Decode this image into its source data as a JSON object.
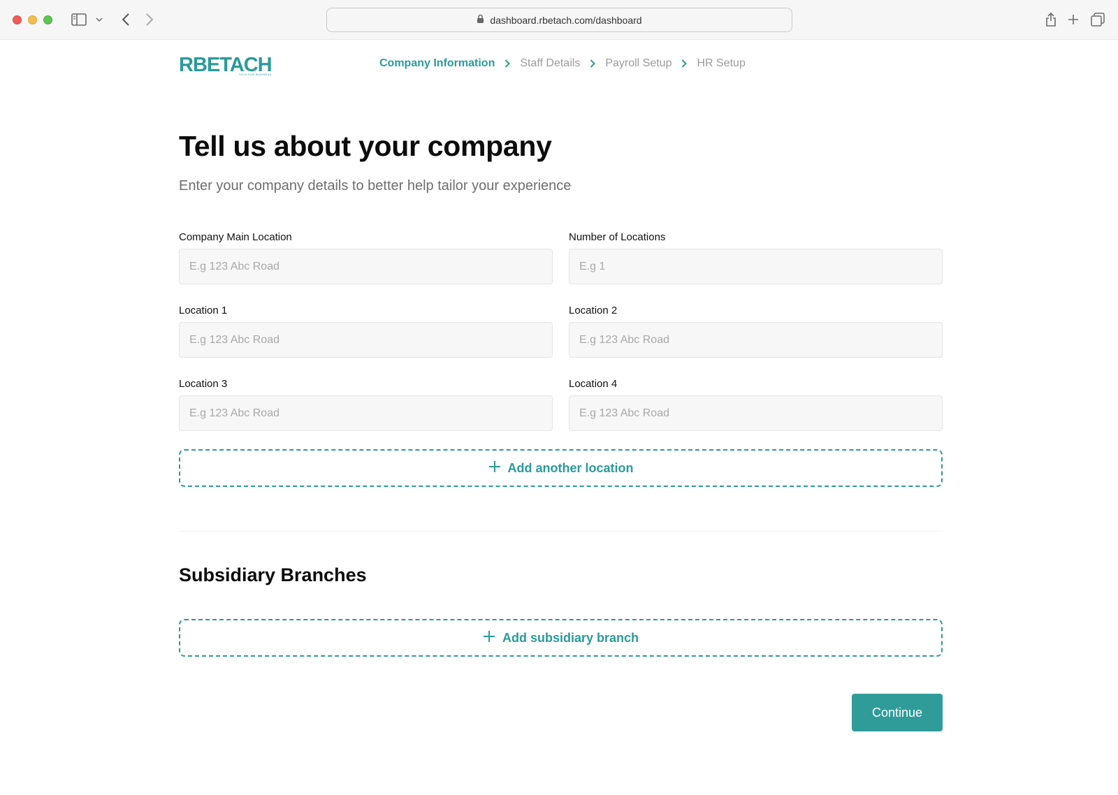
{
  "browser": {
    "url": "dashboard.rbetach.com/dashboard"
  },
  "logo": {
    "name": "RBETACH",
    "tagline": "TECH FOR BUSINESS"
  },
  "stepper": {
    "steps": [
      {
        "label": "Company Information",
        "active": true
      },
      {
        "label": "Staff Details",
        "active": false
      },
      {
        "label": "Payroll Setup",
        "active": false
      },
      {
        "label": "HR Setup",
        "active": false
      }
    ]
  },
  "page": {
    "title": "Tell us about your company",
    "subtitle": "Enter your company details to better help tailor your experience"
  },
  "form": {
    "main_location": {
      "label": "Company Main Location",
      "placeholder": "E.g 123 Abc Road",
      "value": ""
    },
    "num_locations": {
      "label": "Number of Locations",
      "placeholder": "E.g 1",
      "value": ""
    },
    "location_1": {
      "label": "Location 1",
      "placeholder": "E.g 123 Abc Road",
      "value": ""
    },
    "location_2": {
      "label": "Location 2",
      "placeholder": "E.g 123 Abc Road",
      "value": ""
    },
    "location_3": {
      "label": "Location 3",
      "placeholder": "E.g 123 Abc Road",
      "value": ""
    },
    "location_4": {
      "label": "Location 4",
      "placeholder": "E.g 123 Abc Road",
      "value": ""
    },
    "add_location_label": "Add another location"
  },
  "subsidiary": {
    "title": "Subsidiary Branches",
    "add_label": "Add subsidiary branch"
  },
  "actions": {
    "continue_label": "Continue"
  },
  "colors": {
    "brand": "#2a9b9a",
    "muted_text": "#9a9a9a"
  }
}
